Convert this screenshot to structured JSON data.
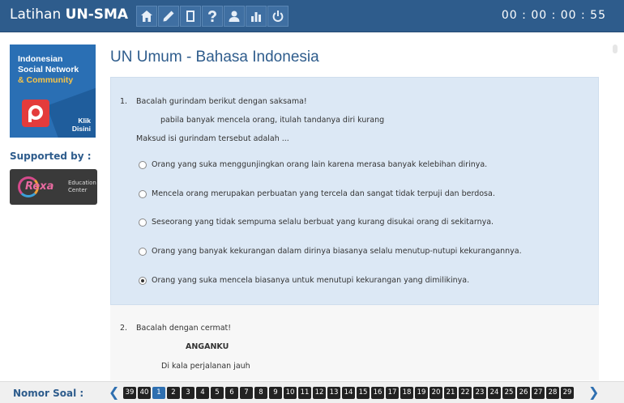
{
  "header": {
    "brand_light": "Latihan ",
    "brand_bold": "UN-SMA",
    "nav_icons": [
      "home-icon",
      "pencil-icon",
      "book-icon",
      "help-icon",
      "user-icon",
      "chart-icon",
      "power-icon"
    ],
    "timer": "00 : 00 : 00 : 55"
  },
  "sidebar": {
    "ad_lines": [
      "Indonesian",
      "Social Network",
      "& Community"
    ],
    "ad_cta": [
      "Klik",
      "Disini"
    ],
    "supported_label": "Supported by :",
    "sponsor_logo": "Rexa",
    "sponsor_text": [
      "Education",
      "Center"
    ]
  },
  "main": {
    "title": "UN Umum - Bahasa Indonesia",
    "question1": {
      "number": "1.",
      "prompt": "Bacalah gurindam berikut dengan saksama!",
      "quote": "pabila banyak mencela orang, itulah tandanya diri kurang",
      "ask": "Maksud isi gurindam tersebut adalah ...",
      "options": [
        {
          "text": "Orang yang suka menggunjingkan orang lain karena merasa banyak kelebihan dirinya.",
          "selected": false
        },
        {
          "text": "Mencela orang merupakan perbuatan yang tercela dan sangat tidak terpuji dan berdosa.",
          "selected": false
        },
        {
          "text": "Seseorang yang tidak sempuma selalu berbuat yang kurang disukai orang di sekitarnya.",
          "selected": false
        },
        {
          "text": "Orang yang banyak kekurangan dalam dirinya biasanya selalu menutup-nutupi kekurangannya.",
          "selected": false
        },
        {
          "text": "Orang yang suka mencela biasanya untuk menutupi kekurangan yang dimilikinya.",
          "selected": true
        }
      ]
    },
    "question2": {
      "number": "2.",
      "prompt": "Bacalah dengan cermat!",
      "heading": "ANGANKU",
      "line1": "Di kala perjalanan jauh"
    }
  },
  "footer": {
    "label": "Nomor Soal :",
    "prev_icon": "chevron-left-icon",
    "next_icon": "chevron-right-icon",
    "numbers": [
      "39",
      "40",
      "1",
      "2",
      "3",
      "4",
      "5",
      "6",
      "7",
      "8",
      "9",
      "10",
      "11",
      "12",
      "13",
      "14",
      "15",
      "16",
      "17",
      "18",
      "19",
      "20",
      "21",
      "22",
      "23",
      "24",
      "25",
      "26",
      "27",
      "28",
      "29"
    ],
    "current": "1"
  }
}
